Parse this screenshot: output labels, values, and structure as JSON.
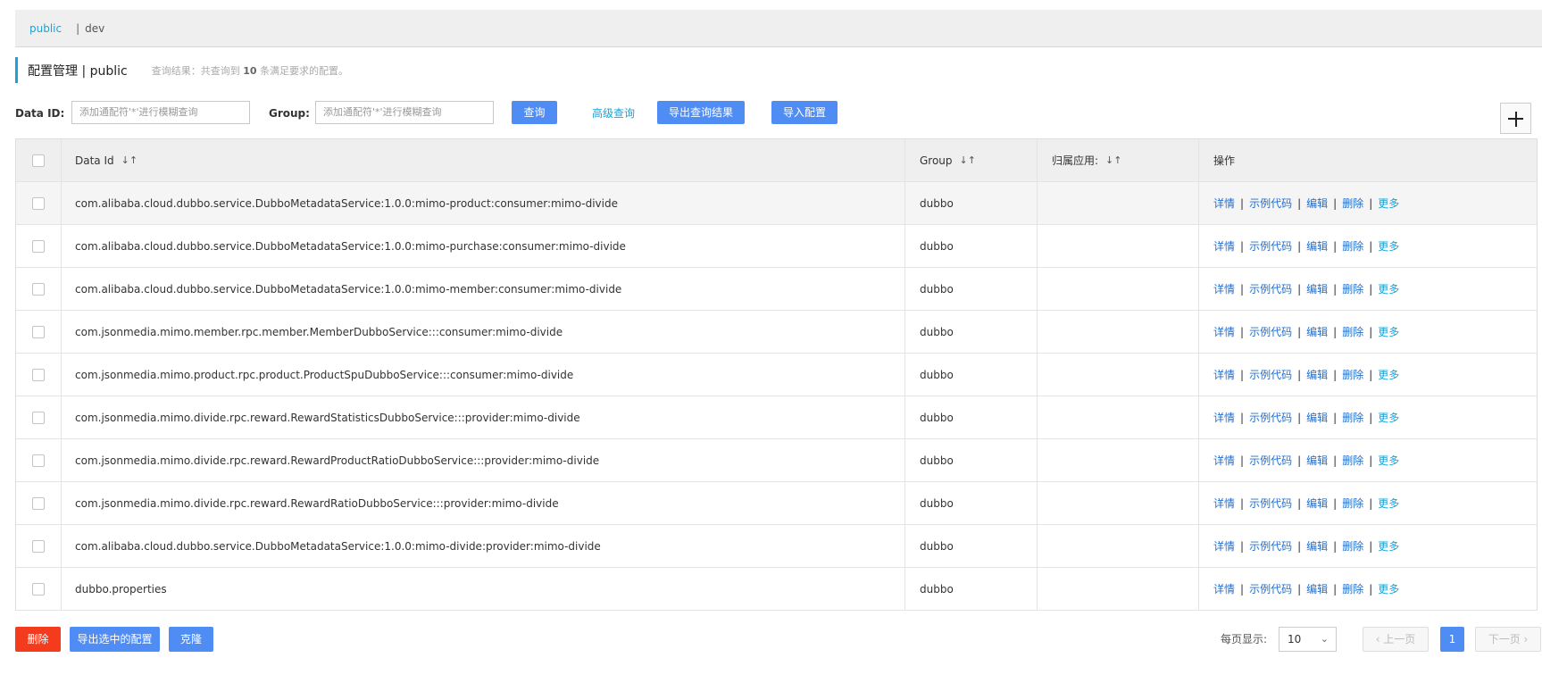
{
  "namespace_bar": {
    "active": "public",
    "separator": "|",
    "other": "dev"
  },
  "title": {
    "main": "配置管理 | public",
    "summary_prefix": "查询结果：共查询到",
    "summary_count": "10",
    "summary_suffix": "条满足要求的配置。"
  },
  "filters": {
    "dataid_label": "Data ID:",
    "dataid_placeholder": "添加通配符'*'进行模糊查询",
    "group_label": "Group:",
    "group_placeholder": "添加通配符'*'进行模糊查询",
    "query_button": "查询",
    "advanced_link": "高级查询",
    "export_button": "导出查询结果",
    "import_button": "导入配置"
  },
  "table": {
    "headers": {
      "data_id": "Data Id",
      "group": "Group",
      "app": "归属应用:",
      "ops": "操作",
      "sort_symbol": "↓↑"
    },
    "rows": [
      {
        "data_id": "com.alibaba.cloud.dubbo.service.DubboMetadataService:1.0.0:mimo-product:consumer:mimo-divide",
        "group": "dubbo",
        "app": ""
      },
      {
        "data_id": "com.alibaba.cloud.dubbo.service.DubboMetadataService:1.0.0:mimo-purchase:consumer:mimo-divide",
        "group": "dubbo",
        "app": ""
      },
      {
        "data_id": "com.alibaba.cloud.dubbo.service.DubboMetadataService:1.0.0:mimo-member:consumer:mimo-divide",
        "group": "dubbo",
        "app": ""
      },
      {
        "data_id": "com.jsonmedia.mimo.member.rpc.member.MemberDubboService:::consumer:mimo-divide",
        "group": "dubbo",
        "app": ""
      },
      {
        "data_id": "com.jsonmedia.mimo.product.rpc.product.ProductSpuDubboService:::consumer:mimo-divide",
        "group": "dubbo",
        "app": ""
      },
      {
        "data_id": "com.jsonmedia.mimo.divide.rpc.reward.RewardStatisticsDubboService:::provider:mimo-divide",
        "group": "dubbo",
        "app": ""
      },
      {
        "data_id": "com.jsonmedia.mimo.divide.rpc.reward.RewardProductRatioDubboService:::provider:mimo-divide",
        "group": "dubbo",
        "app": ""
      },
      {
        "data_id": "com.jsonmedia.mimo.divide.rpc.reward.RewardRatioDubboService:::provider:mimo-divide",
        "group": "dubbo",
        "app": ""
      },
      {
        "data_id": "com.alibaba.cloud.dubbo.service.DubboMetadataService:1.0.0:mimo-divide:provider:mimo-divide",
        "group": "dubbo",
        "app": ""
      },
      {
        "data_id": "dubbo.properties",
        "group": "dubbo",
        "app": ""
      }
    ],
    "ops": {
      "detail": "详情",
      "sample": "示例代码",
      "edit": "编辑",
      "delete": "删除",
      "more": "更多",
      "separator": "|"
    }
  },
  "bottom": {
    "delete_button": "删除",
    "export_selected_button": "导出选中的配置",
    "clone_button": "克隆",
    "per_page_label": "每页显示:",
    "per_page_value": "10",
    "prev_label": "‹ 上一页",
    "current_page": "1",
    "next_label": "下一页 ›"
  },
  "colors": {
    "accent": "#1aa3d8",
    "primary_button": "#4f8df5",
    "danger_button": "#f53b1d",
    "link": "#1f6fcf"
  }
}
